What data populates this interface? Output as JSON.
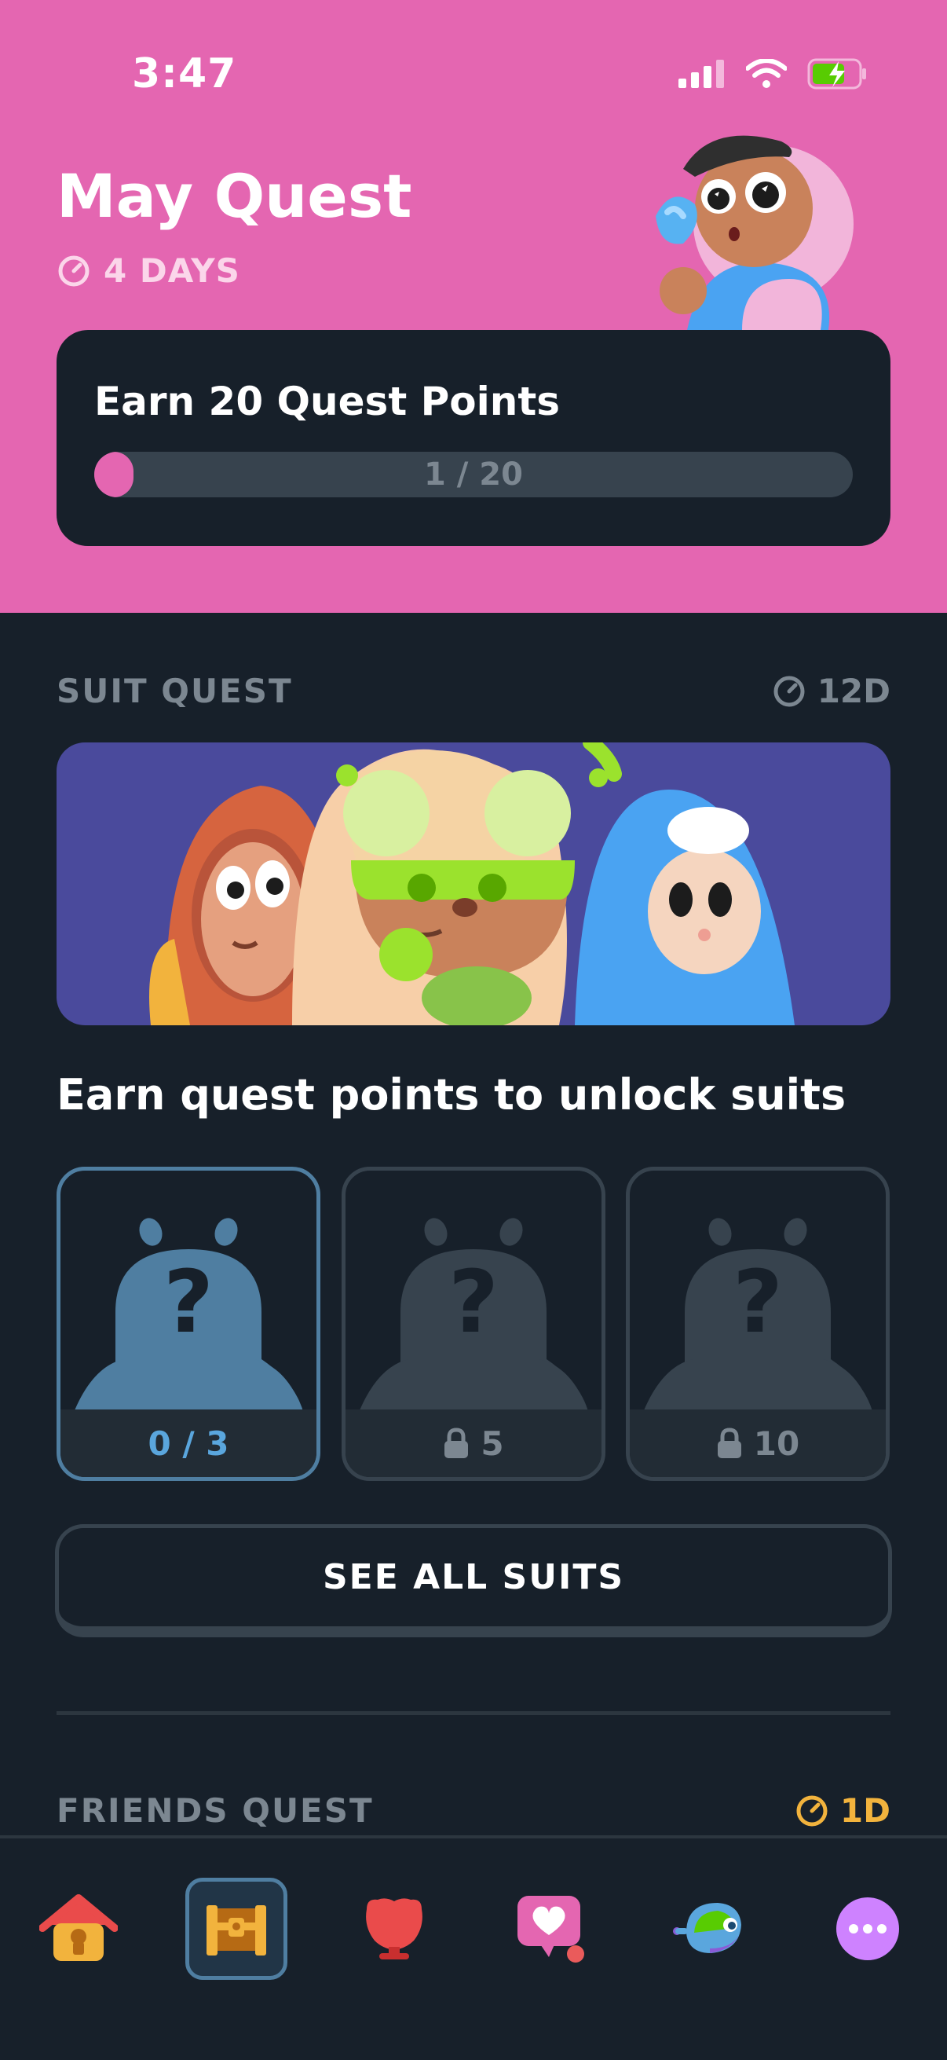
{
  "status": {
    "time": "3:47"
  },
  "header": {
    "title": "May Quest",
    "days_left": "4 DAYS",
    "card": {
      "title": "Earn 20 Quest Points",
      "progress_text": "1 / 20",
      "progress_value": 1,
      "progress_max": 20
    }
  },
  "suit_quest": {
    "label": "SUIT QUEST",
    "time_left": "12D",
    "subtitle": "Earn quest points to unlock suits",
    "suits": [
      {
        "footer": "0 / 3",
        "locked": false
      },
      {
        "footer": "5",
        "locked": true
      },
      {
        "footer": "10",
        "locked": true
      }
    ],
    "see_all_label": "SEE ALL SUITS"
  },
  "friends_quest": {
    "label": "FRIENDS QUEST",
    "time_left": "1D"
  },
  "tabs": [
    {
      "name": "home-tab",
      "icon": "house-icon"
    },
    {
      "name": "quests-tab",
      "icon": "treasure-chest-icon",
      "active": true
    },
    {
      "name": "leagues-tab",
      "icon": "trophy-icon"
    },
    {
      "name": "friends-tab",
      "icon": "heart-chat-icon"
    },
    {
      "name": "shop-tab",
      "icon": "bird-icon"
    },
    {
      "name": "more-tab",
      "icon": "more-icon"
    }
  ],
  "colors": {
    "accent_pink": "#e466b1",
    "background": "#17202a",
    "active_blue": "#4f7ea1",
    "gold": "#f2b33d"
  }
}
